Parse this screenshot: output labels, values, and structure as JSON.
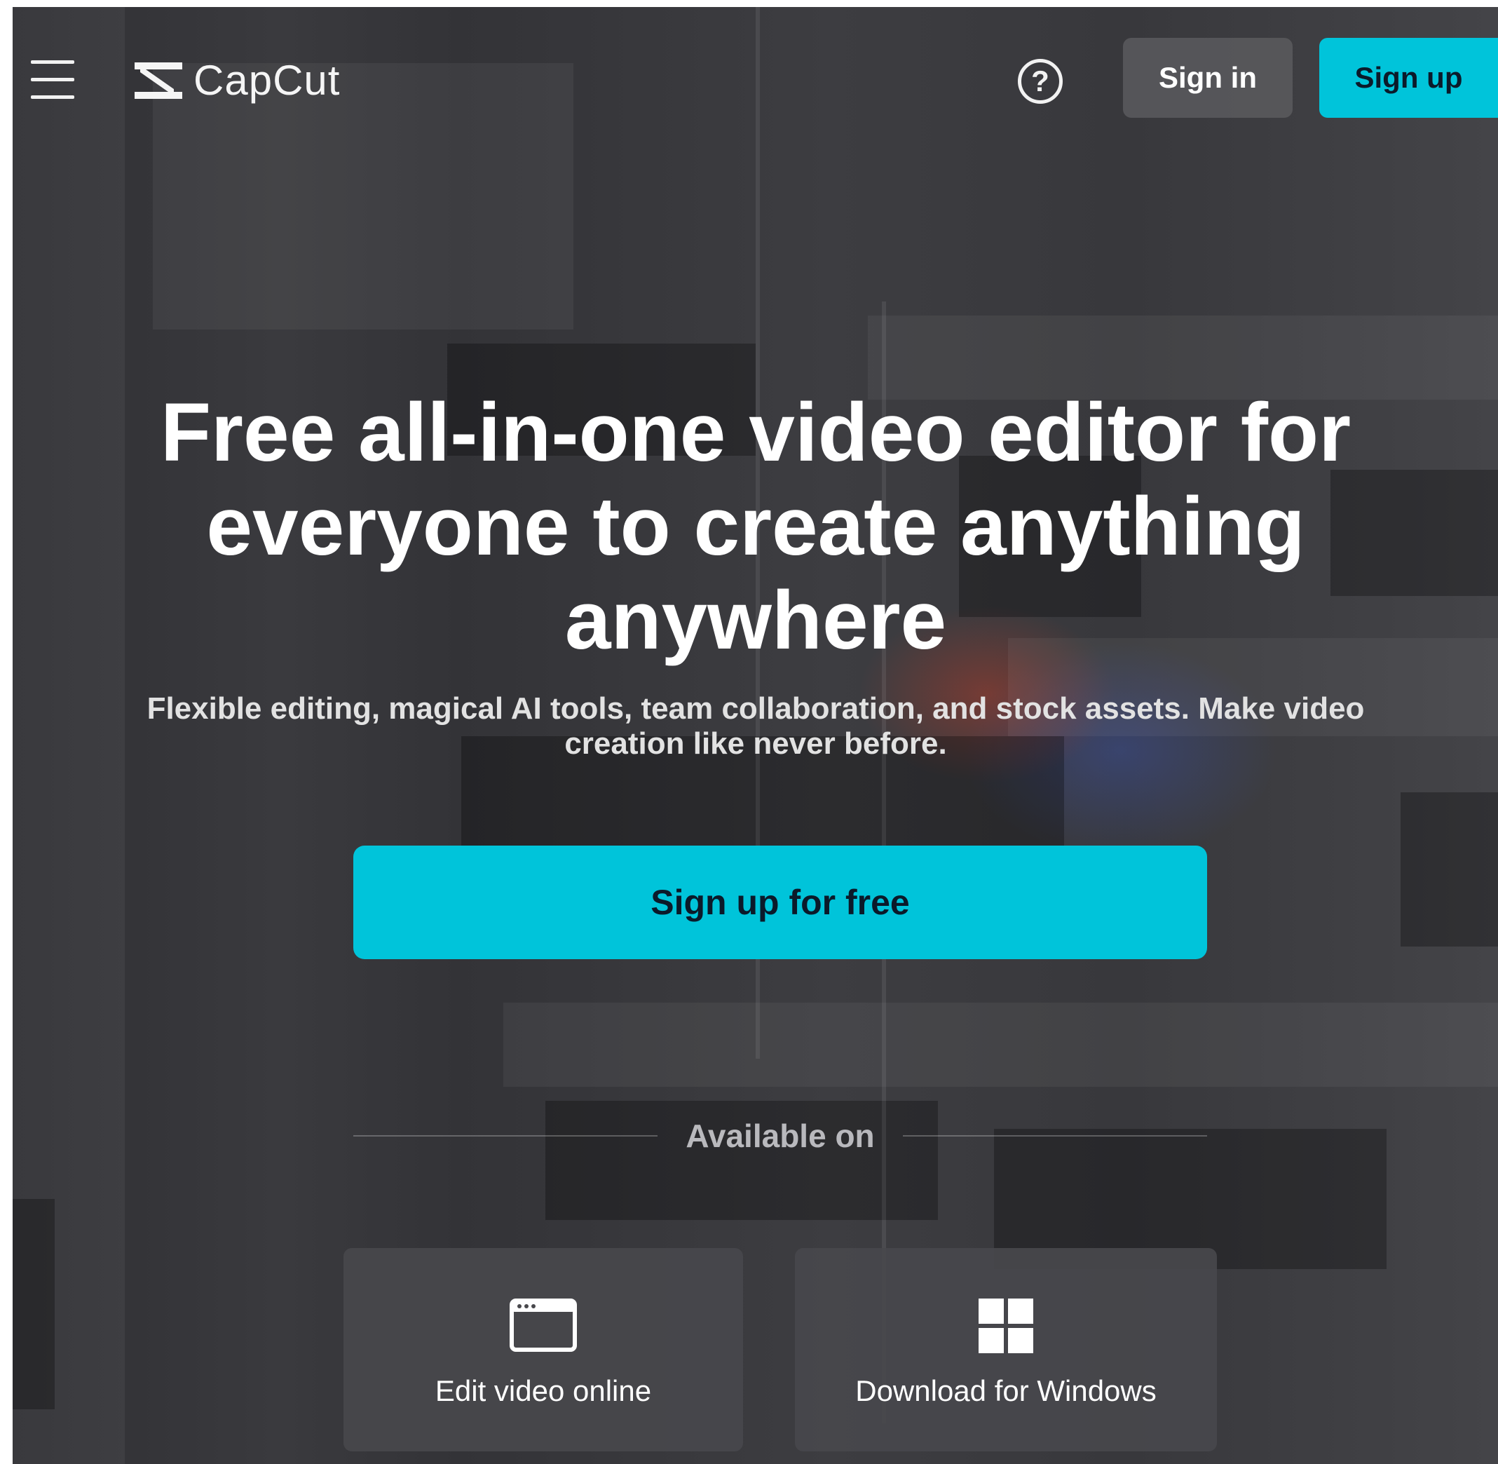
{
  "header": {
    "menu_icon": "hamburger-menu-icon",
    "logo_text": "CapCut",
    "help_icon": "question-circle-icon",
    "help_glyph": "?",
    "sign_in_label": "Sign in",
    "sign_up_label": "Sign up"
  },
  "hero": {
    "title": "Free all-in-one video editor for everyone to create anything anywhere",
    "subtitle": "Flexible editing, magical AI tools, team collaboration, and stock assets. Make video creation like never before.",
    "cta_label": "Sign up for free"
  },
  "platforms": {
    "heading": "Available on",
    "items": [
      {
        "label": "Edit video online",
        "icon": "browser-window-icon"
      },
      {
        "label": "Download for Windows",
        "icon": "windows-logo-icon"
      }
    ]
  },
  "colors": {
    "accent": "#00c4da",
    "background": "#38383c",
    "card": "#48484c"
  }
}
